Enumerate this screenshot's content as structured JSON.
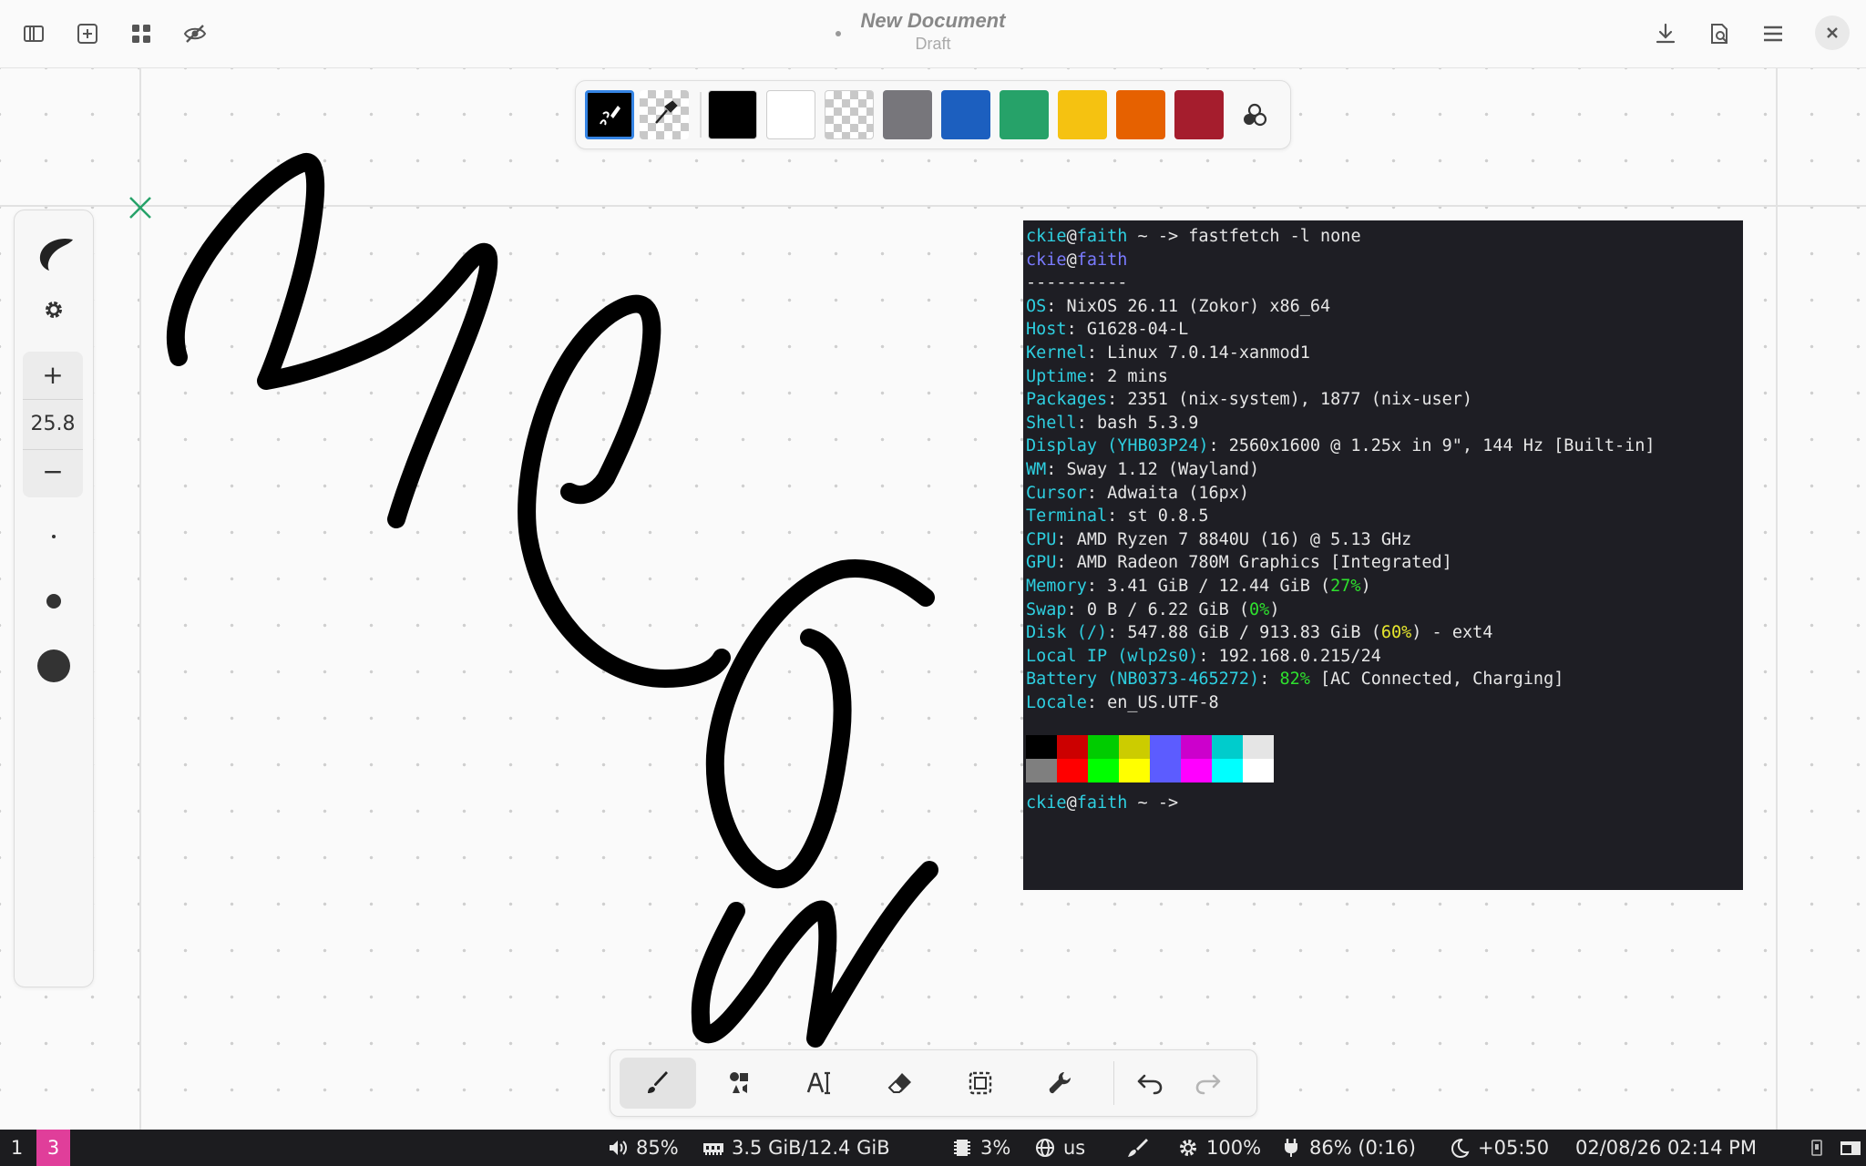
{
  "header": {
    "title": "New Document",
    "subtitle": "Draft"
  },
  "palette": {
    "colors": [
      "#000000",
      "#ffffff",
      "transparent",
      "#77767b",
      "#1c5fbf",
      "#26a269",
      "#f5c211",
      "#e66100",
      "#a51d2d"
    ]
  },
  "left_toolbar": {
    "zoom_in": "+",
    "zoom_value": "25.8",
    "zoom_out": "−"
  },
  "terminal": {
    "prompt_user": "ckie",
    "prompt_host": "faith",
    "prompt_rest": " ~ -> ",
    "command": "fastfetch -l none",
    "separator": "----------",
    "info": [
      {
        "key": "OS",
        "value": ": NixOS 26.11 (Zokor) x86_64"
      },
      {
        "key": "Host",
        "value": ": G1628-04-L"
      },
      {
        "key": "Kernel",
        "value": ": Linux 7.0.14-xanmod1"
      },
      {
        "key": "Uptime",
        "value": ": 2 mins"
      },
      {
        "key": "Packages",
        "value": ": 2351 (nix-system), 1877 (nix-user)"
      },
      {
        "key": "Shell",
        "value": ": bash 5.3.9"
      },
      {
        "key": "Display (YHB03P24)",
        "value": ": 2560x1600 @ 1.25x in 9\", 144 Hz [Built-in]"
      },
      {
        "key": "WM",
        "value": ": Sway 1.12 (Wayland)"
      },
      {
        "key": "Cursor",
        "value": ": Adwaita (16px)"
      },
      {
        "key": "Terminal",
        "value": ": st 0.8.5"
      },
      {
        "key": "CPU",
        "value": ": AMD Ryzen 7 8840U (16) @ 5.13 GHz"
      },
      {
        "key": "GPU",
        "value": ": AMD Radeon 780M Graphics [Integrated]"
      }
    ],
    "memory": {
      "key": "Memory",
      "pre": ": 3.41 GiB / 12.44 GiB (",
      "pct": "27%",
      "post": ")"
    },
    "swap": {
      "key": "Swap",
      "pre": ": 0 B / 6.22 GiB (",
      "pct": "0%",
      "post": ")"
    },
    "disk": {
      "key": "Disk (/)",
      "pre": ": 547.88 GiB / 913.83 GiB (",
      "pct": "60%",
      "post": ") - ext4"
    },
    "localip": {
      "key": "Local IP (wlp2s0)",
      "value": ": 192.168.0.215/24"
    },
    "battery": {
      "key": "Battery (NB0373-465272)",
      "sep": ": ",
      "pct": "82%",
      "post": " [AC Connected, Charging]"
    },
    "locale": {
      "key": "Locale",
      "value": ": en_US.UTF-8"
    },
    "term_colors_top": [
      "#000000",
      "#cc0000",
      "#00cc00",
      "#cccc00",
      "#5c5cff",
      "#cc00cc",
      "#00cccc",
      "#e5e5e5"
    ],
    "term_colors_bottom": [
      "#7f7f7f",
      "#ff0000",
      "#00ff00",
      "#ffff00",
      "#5c5cff",
      "#ff00ff",
      "#00ffff",
      "#ffffff"
    ]
  },
  "statusbar": {
    "ws1": "1",
    "ws3": "3",
    "volume": "85%",
    "memory": "3.5 GiB/12.4 GiB",
    "cpu": "3%",
    "layout": "us",
    "brightness": "100%",
    "battery": "86% (0:16)",
    "offset": "+05:50",
    "datetime": "02/08/26 02:14 PM"
  }
}
